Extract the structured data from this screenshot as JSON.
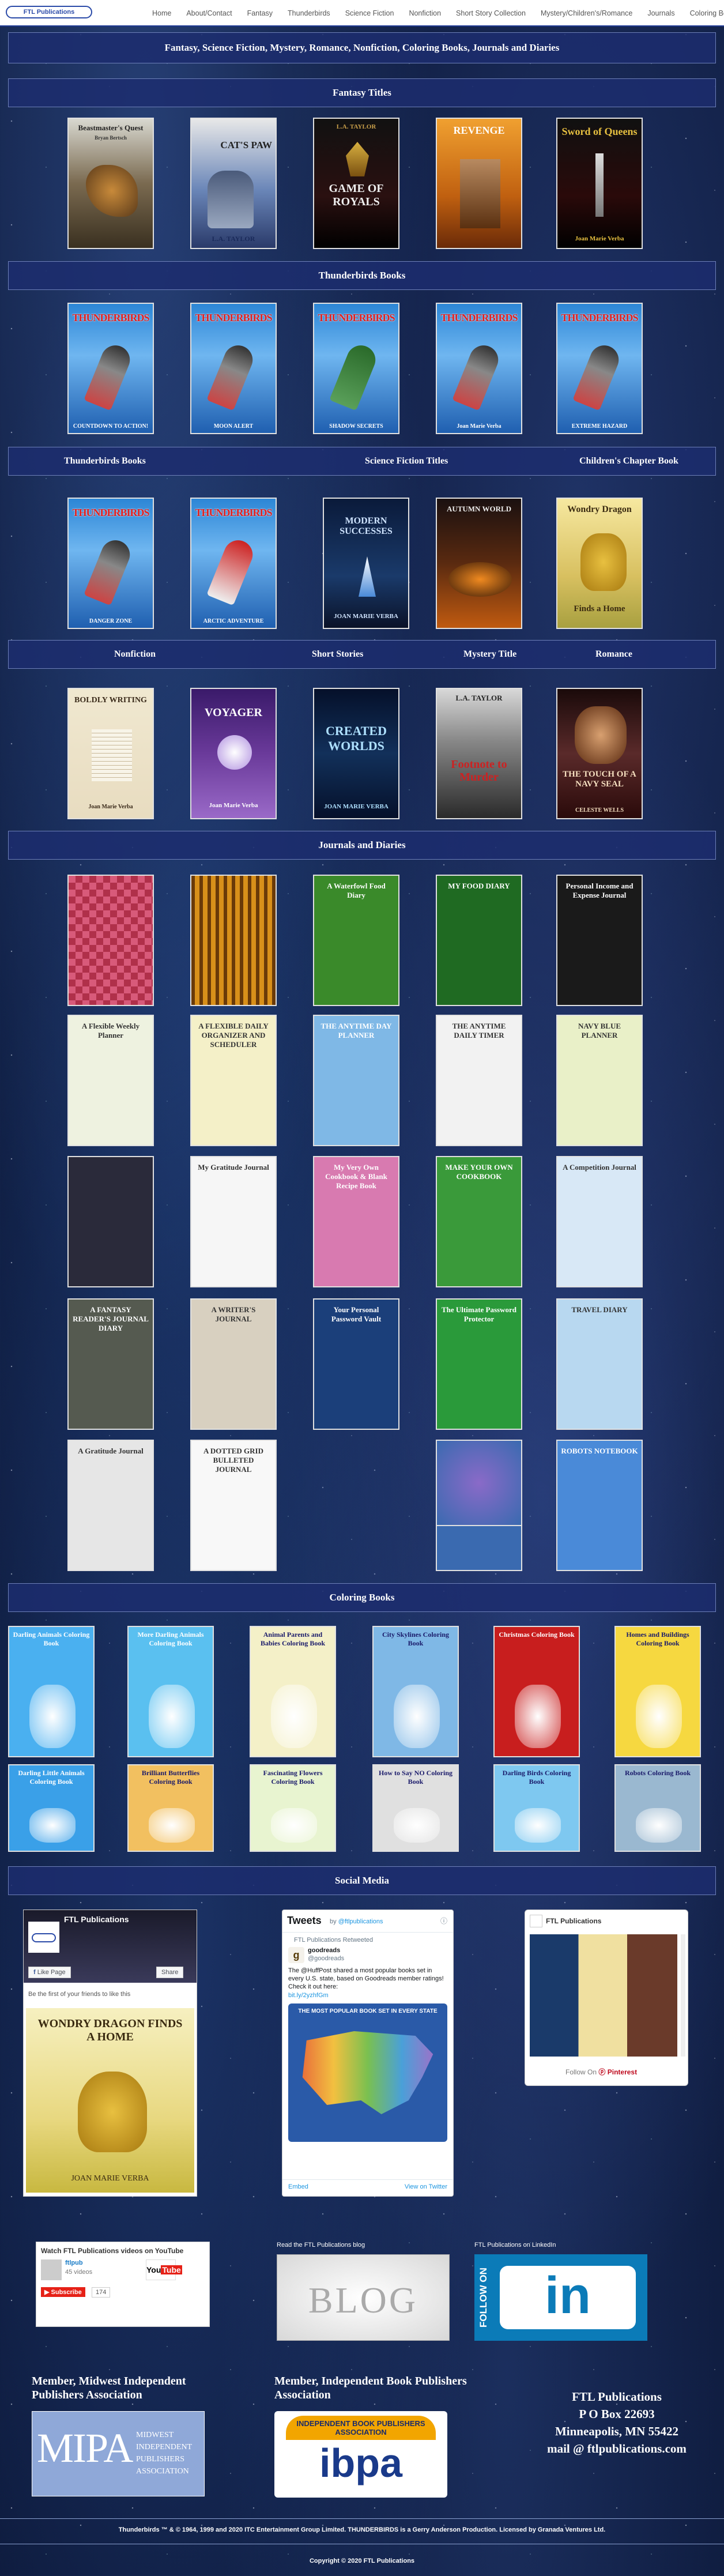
{
  "nav": {
    "logo": "FTL Publications",
    "items": [
      "Home",
      "About/Contact",
      "Fantasy",
      "Thunderbirds",
      "Science Fiction",
      "Nonfiction",
      "Short Story Collection",
      "Mystery/Children's/Romance",
      "Journals",
      "Coloring Books"
    ]
  },
  "banner": "Fantasy, Science Fiction, Mystery, Romance, Nonfiction, Coloring Books, Journals and Diaries",
  "sections": {
    "fantasy": "Fantasy Titles",
    "thunderbirds": "Thunderbirds Books",
    "tb2": "Thunderbirds Books",
    "scifi": "Science Fiction Titles",
    "children": "Children's Chapter Book",
    "nonfiction": "Nonfiction",
    "short": "Short Stories",
    "mystery": "Mystery Title",
    "romance": "Romance",
    "journals": "Journals and Diaries",
    "coloring": "Coloring Books",
    "social": "Social Media"
  },
  "fantasy_books": [
    {
      "title": "Beastmaster's Quest",
      "author": "Bryan Bertsch"
    },
    {
      "title": "CAT'S PAW",
      "author": "L.A. TAYLOR"
    },
    {
      "title": "GAME OF ROYALS",
      "author": "L.A. TAYLOR"
    },
    {
      "title": "REVENGE",
      "author": ""
    },
    {
      "title": "Sword of Queens",
      "author": "Joan Marie Verba"
    }
  ],
  "tb_books": [
    {
      "title": "THUNDERBIRDS",
      "sub": "COUNTDOWN TO ACTION!"
    },
    {
      "title": "THUNDERBIRDS",
      "sub": "MOON ALERT"
    },
    {
      "title": "THUNDERBIRDS",
      "sub": "SHADOW SECRETS"
    },
    {
      "title": "THUNDERBIRDS",
      "sub": "Joan Marie Verba"
    },
    {
      "title": "THUNDERBIRDS",
      "sub": "EXTREME HAZARD"
    }
  ],
  "tb_books2": [
    {
      "title": "THUNDERBIRDS",
      "sub": "DANGER ZONE"
    },
    {
      "title": "THUNDERBIRDS",
      "sub": "ARCTIC ADVENTURE"
    }
  ],
  "scifi_books": [
    {
      "title": "MODERN SUCCESSES",
      "author": "JOAN MARIE VERBA"
    },
    {
      "title": "AUTUMN WORLD",
      "author": ""
    }
  ],
  "children_book": {
    "title": "Wondry Dragon",
    "sub": "Finds a Home"
  },
  "row4": [
    {
      "title": "BOLDLY WRITING",
      "author": "Joan Marie Verba"
    },
    {
      "title": "VOYAGER",
      "author": "Joan Marie Verba"
    },
    {
      "title": "CREATED WORLDS",
      "author": "JOAN MARIE VERBA"
    },
    {
      "title": "Footnote to Murder",
      "author": "L.A. TAYLOR"
    },
    {
      "title": "THE TOUCH OF A NAVY SEAL",
      "author": "CELESTE WELLS"
    }
  ],
  "journals": [
    {
      "title": "",
      "bg": "#b0304a"
    },
    {
      "title": "",
      "bg": "#a06018"
    },
    {
      "title": "A Waterfowl Food Diary",
      "bg": "#3a8a2a"
    },
    {
      "title": "MY FOOD DIARY",
      "bg": "#1f6a22"
    },
    {
      "title": "Personal Income and Expense Journal",
      "bg": "#1a1a1a"
    },
    {
      "title": "A Flexible Weekly Planner",
      "bg": "#eef2e0"
    },
    {
      "title": "A FLEXIBLE DAILY ORGANIZER AND SCHEDULER",
      "bg": "#f4f0c8"
    },
    {
      "title": "THE ANYTIME DAY PLANNER",
      "bg": "#7fb8e6"
    },
    {
      "title": "THE ANYTIME DAILY TIMER",
      "bg": "#f2f2f2"
    },
    {
      "title": "NAVY BLUE PLANNER",
      "bg": "#e9f0c8"
    },
    {
      "title": "",
      "bg": "#2a2a3a"
    },
    {
      "title": "My Gratitude Journal",
      "bg": "#f6f6f6"
    },
    {
      "title": "My Very Own Cookbook & Blank Recipe Book",
      "bg": "#d87ab0"
    },
    {
      "title": "MAKE YOUR OWN COOKBOOK",
      "bg": "#3a9a3a"
    },
    {
      "title": "A Competition Journal",
      "bg": "#d8e8f6"
    },
    {
      "title": "A FANTASY READER'S JOURNAL DIARY",
      "bg": "#555a50"
    },
    {
      "title": "A WRITER'S JOURNAL",
      "bg": "#d8d0c0"
    },
    {
      "title": "Your Personal Password Vault",
      "bg": "#1b3f7a"
    },
    {
      "title": "The Ultimate Password Protector",
      "bg": "#2a9a3a"
    },
    {
      "title": "TRAVEL DIARY",
      "bg": "#b8d8f0"
    },
    {
      "title": "A Gratitude Journal",
      "bg": "#e6e6e6"
    },
    {
      "title": "A DOTTED GRID BULLETED JOURNAL",
      "bg": "#f8f8f8"
    },
    {
      "title": "",
      "bg": ""
    },
    {
      "title": "",
      "bg": "#3a6ab0"
    },
    {
      "title": "ROBOTS NOTEBOOK",
      "bg": "#4a8ad8"
    }
  ],
  "coloring": [
    {
      "title": "Darling Animals Coloring Book",
      "bg": "#4ab0f0"
    },
    {
      "title": "More Darling Animals Coloring Book",
      "bg": "#5ac0f0"
    },
    {
      "title": "Animal Parents and Babies Coloring Book",
      "bg": "#f4f0c8"
    },
    {
      "title": "City Skylines Coloring Book",
      "bg": "#7fb8e6"
    },
    {
      "title": "Christmas Coloring Book",
      "bg": "#c81e1e"
    },
    {
      "title": "Homes and Buildings Coloring Book",
      "bg": "#f6d840"
    },
    {
      "title": "Darling Little Animals Coloring Book",
      "bg": "#3aa0e8"
    },
    {
      "title": "Brilliant Butterflies Coloring Book",
      "bg": "#f2c060"
    },
    {
      "title": "Fascinating Flowers Coloring Book",
      "bg": "#e8f4d0"
    },
    {
      "title": "How to Say NO Coloring Book",
      "bg": "#e0e0e0"
    },
    {
      "title": "Darling Birds Coloring Book",
      "bg": "#7ec8f0"
    },
    {
      "title": "Robots Coloring Book",
      "bg": "#9ab8d0"
    }
  ],
  "social": {
    "fb": {
      "name": "FTL Publications",
      "like": "Like Page",
      "share": "Share",
      "first": "Be the first of your friends to like this",
      "book_title": "WONDRY DRAGON FINDS A HOME",
      "book_author": "JOAN MARIE VERBA"
    },
    "tw": {
      "title": "Tweets",
      "by": "by",
      "handle": "@ftlpublications",
      "retweet": "FTL Publications Retweeted",
      "user": "goodreads",
      "user_handle": "@goodreads",
      "text": "The @HuffPost shared a most popular books set in every U.S. state, based on Goodreads member ratings! Check it out here:",
      "link": "bit.ly/2yzhfGm",
      "map_title": "THE MOST POPULAR BOOK SET IN EVERY STATE",
      "embed": "Embed",
      "view": "View on Twitter"
    },
    "pin": {
      "name": "FTL Publications",
      "follow": "Follow On",
      "brand": "Pinterest"
    },
    "yt": {
      "title": "Watch FTL Publications videos on YouTube",
      "chan": "ftlpub",
      "count": "45 videos",
      "sub": "Subscribe",
      "subs": "174"
    },
    "blog": {
      "label": "Read the FTL Publications blog",
      "img": "BLOG"
    },
    "li": {
      "label": "FTL Publications on LinkedIn",
      "follow": "FOLLOW ON",
      "in": "in"
    }
  },
  "footer_orgs": {
    "mipa_label": "Member, Midwest Independent Publishers Association",
    "mipa_logo": "MIPA",
    "mipa_full": [
      "MIDWEST",
      "INDEPENDENT",
      "PUBLISHERS",
      "ASSOCIATION"
    ],
    "ibpa_label": "Member, Independent Book Publishers Association",
    "ibpa_top": "INDEPENDENT BOOK PUBLISHERS ASSOCIATION",
    "ibpa_logo": "ibpa",
    "addr": [
      "FTL Publications",
      "P O Box 22693",
      "Minneapolis, MN 55422",
      "mail @ ftlpublications.com"
    ]
  },
  "copyright": "Thunderbirds ™ & © 1964, 1999 and 2020 ITC Entertainment Group Limited. THUNDERBIRDS is a Gerry Anderson Production. Licensed by Granada Ventures Ltd.",
  "copyright2": "Copyright © 2020 FTL Publications",
  "colors": {
    "bar": "#1c2d6e",
    "nav_accent": "#2a4aa8"
  }
}
